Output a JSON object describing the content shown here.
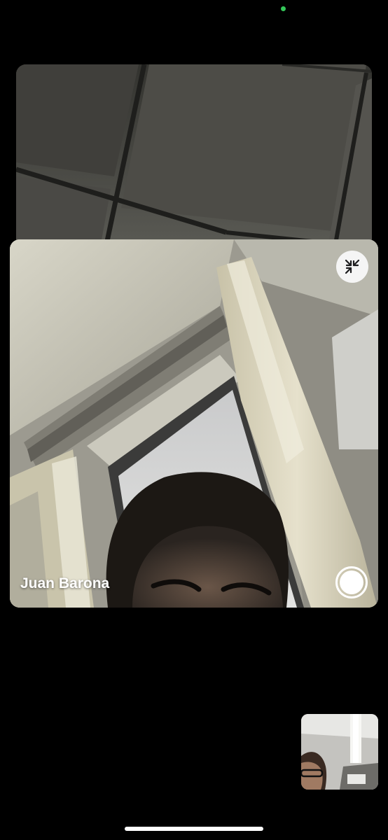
{
  "call": {
    "participant_name": "Juan Barona"
  },
  "controls": {
    "collapse_icon": "collapse-arrows-icon",
    "capture_icon": "live-photo-capture-icon"
  },
  "status": {
    "indicator_color": "#34c759"
  },
  "colors": {
    "background": "#000000",
    "button_fill": "#f5f5f5",
    "name_text": "#ffffff"
  }
}
